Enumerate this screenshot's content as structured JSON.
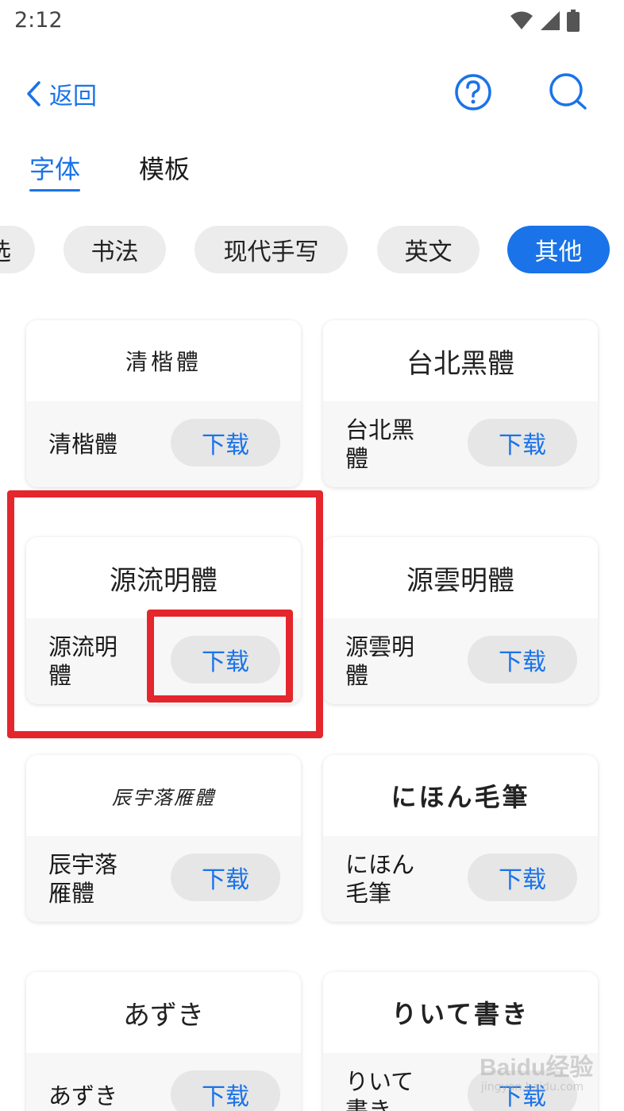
{
  "status_bar": {
    "time": "2:12"
  },
  "header": {
    "back_label": "返回"
  },
  "tabs": [
    {
      "label": "字体",
      "active": true
    },
    {
      "label": "模板",
      "active": false
    }
  ],
  "chips": [
    {
      "label": "选",
      "active": false
    },
    {
      "label": "书法",
      "active": false
    },
    {
      "label": "现代手写",
      "active": false
    },
    {
      "label": "英文",
      "active": false
    },
    {
      "label": "其他",
      "active": true
    }
  ],
  "fonts": [
    {
      "preview": "清楷體",
      "name": "清楷體",
      "download_label": "下载"
    },
    {
      "preview": "台北黑體",
      "name": "台北黑體",
      "download_label": "下载"
    },
    {
      "preview": "源流明體",
      "name": "源流明體",
      "download_label": "下载"
    },
    {
      "preview": "源雲明體",
      "name": "源雲明體",
      "download_label": "下载"
    },
    {
      "preview": "辰宇落雁體",
      "name": "辰宇落雁體",
      "download_label": "下载"
    },
    {
      "preview": "にほん毛筆",
      "name": "にほん毛筆",
      "download_label": "下载"
    },
    {
      "preview": "あずき",
      "name": "あずき",
      "download_label": "下载"
    },
    {
      "preview": "りいて書き",
      "name": "りいて書き",
      "download_label": "下载"
    }
  ],
  "watermark": {
    "text": "Baidu经验",
    "sub": "jingyan.baidu.com"
  },
  "colors": {
    "accent": "#1a73e8",
    "annotation": "#e4262d",
    "chip_bg": "#ececec"
  }
}
